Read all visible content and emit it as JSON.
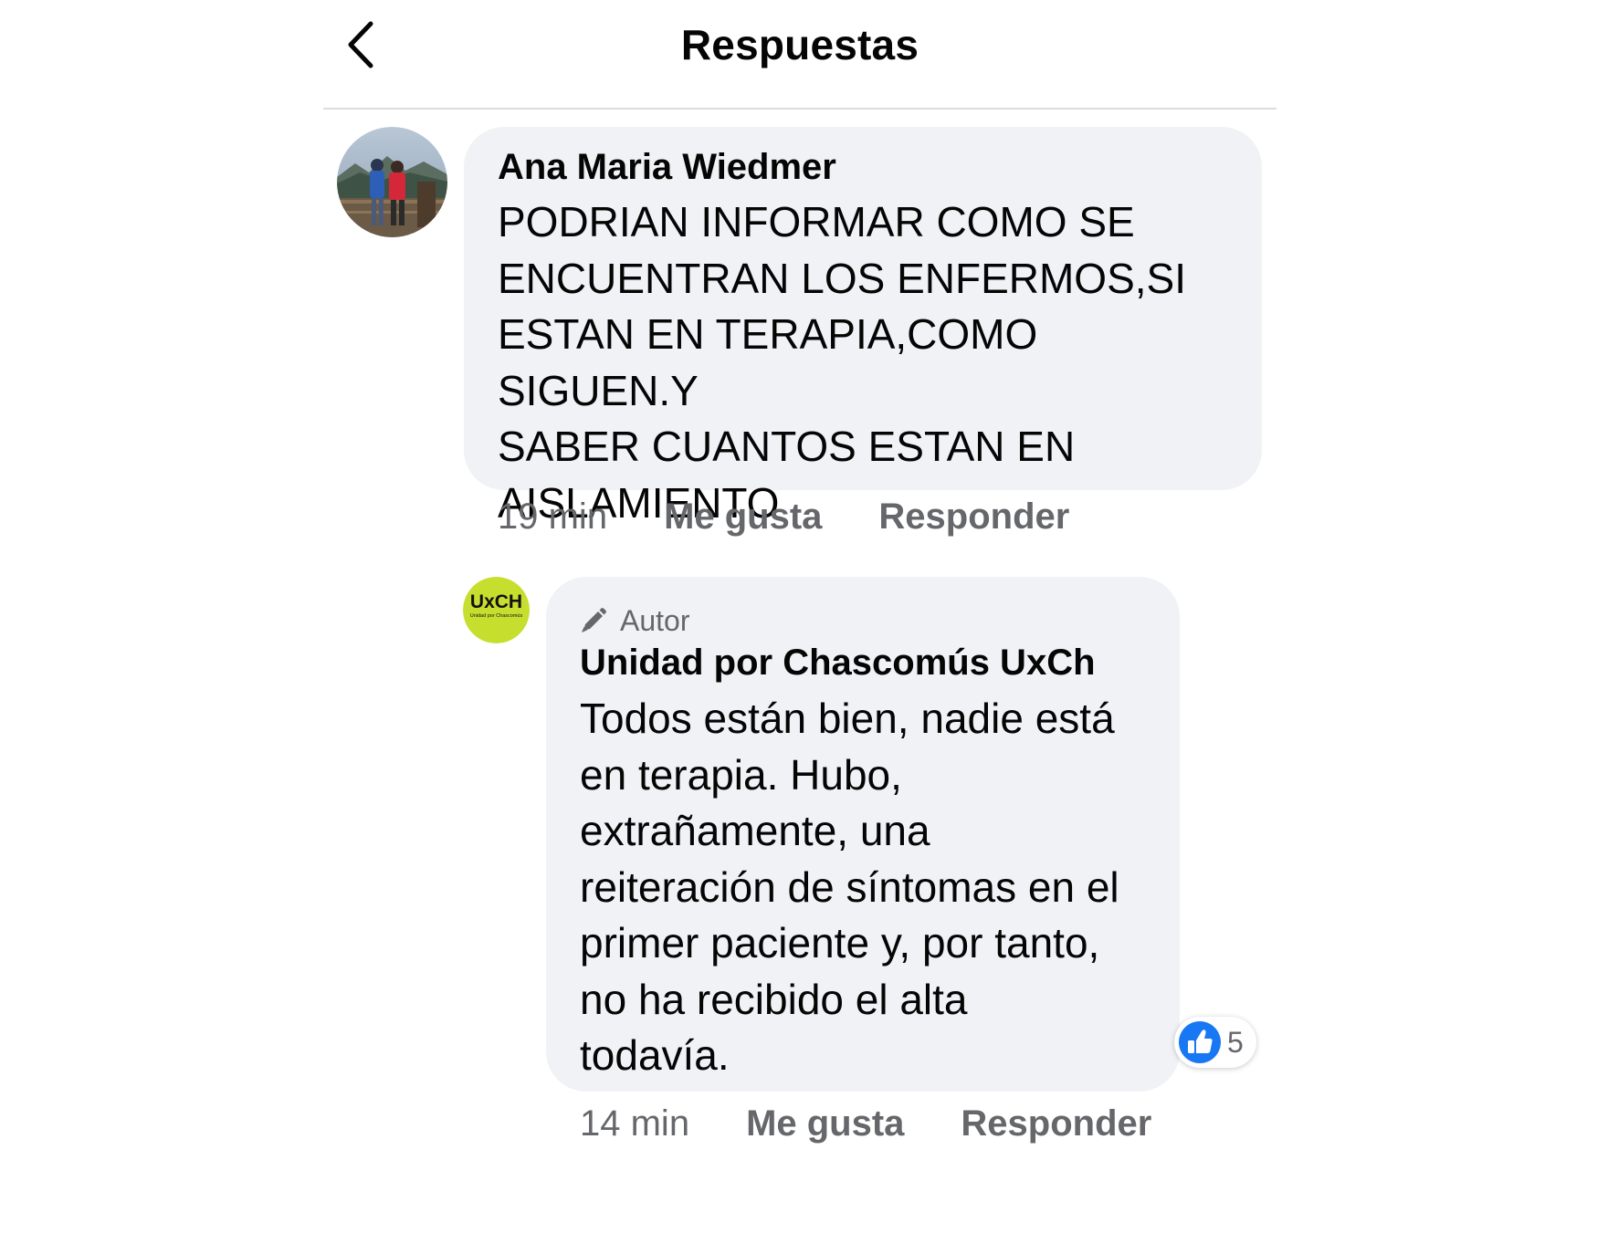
{
  "header": {
    "title": "Respuestas",
    "back_icon": "chevron-left-icon"
  },
  "comments": [
    {
      "author": "Ana Maria Wiedmer",
      "avatar": "profile-photo",
      "text_lines": [
        "PODRIAN INFORMAR COMO SE",
        "ENCUENTRAN LOS ENFERMOS,SI",
        "ESTAN EN TERAPIA,COMO SIGUEN.Y",
        "SABER CUANTOS ESTAN EN",
        "AISLAMIENTO"
      ],
      "time": "19 min",
      "like_label": "Me gusta",
      "reply_label": "Responder"
    },
    {
      "badge_label": "Autor",
      "badge_icon": "pencil-icon",
      "author": "Unidad por Chascomús UxCh",
      "avatar_logo_text": "UxCH",
      "avatar_logo_subtext": "Unidad por Chascomús",
      "text_lines": [
        "Todos están bien, nadie está",
        "en terapia. Hubo,",
        "extrañamente, una",
        "reiteración de síntomas en el",
        "primer paciente y, por tanto,",
        "no ha recibido el alta",
        "todavía."
      ],
      "time": "14 min",
      "like_label": "Me gusta",
      "reply_label": "Responder",
      "reaction_icon": "like-icon",
      "reaction_count": "5"
    }
  ],
  "colors": {
    "bubble": "#f0f2f5",
    "meta_text": "#65676b",
    "like_blue": "#1877f2",
    "logo_yellow": "#c6de2e"
  }
}
